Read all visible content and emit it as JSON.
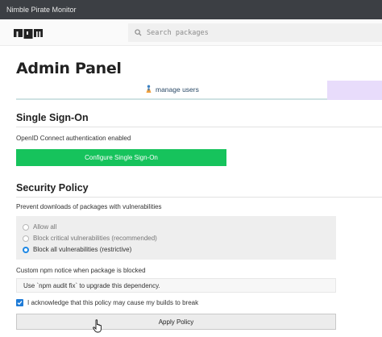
{
  "window": {
    "title": "Nimble Pirate Monitor"
  },
  "nav": {
    "logo_text": "npm",
    "search_placeholder": "Search packages"
  },
  "page": {
    "title": "Admin Panel"
  },
  "tabs": [
    {
      "label": "manage users",
      "icon": "users-icon"
    }
  ],
  "sso": {
    "title": "Single Sign-On",
    "status": "OpenID Connect authentication enabled",
    "button_label": "Configure Single Sign-On"
  },
  "security": {
    "title": "Security Policy",
    "question": "Prevent downloads of packages with vulnerabilities",
    "options": [
      {
        "label": "Allow all",
        "selected": false
      },
      {
        "label": "Block critical vulnerabilities (recommended)",
        "selected": false
      },
      {
        "label": "Block all vulnerabilities (restrictive)",
        "selected": true
      }
    ],
    "notice_label": "Custom npm notice when package is blocked",
    "notice_value": "Use `npm audit fix` to upgrade this dependency.",
    "ack_label": "I acknowledge that this policy may cause my builds to break",
    "ack_checked": true,
    "apply_label": "Apply Policy"
  },
  "colors": {
    "accent_green": "#16c35c",
    "radio_blue": "#1e88e5",
    "tab_purple": "#e8dcfb"
  }
}
